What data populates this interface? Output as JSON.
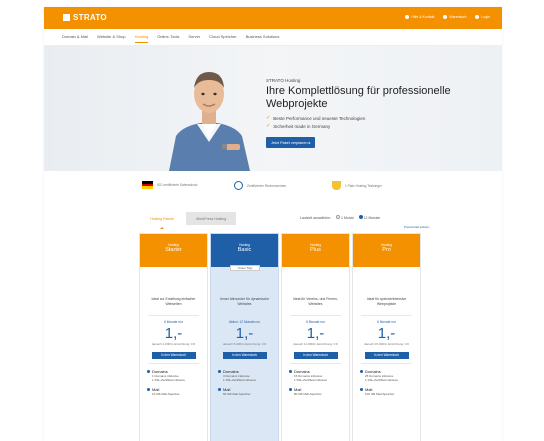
{
  "brand": {
    "name": "STRATO",
    "color": "#f39100",
    "blue": "#1f5fa8"
  },
  "toplinks": [
    "Hilfe & Kontakt",
    "Warenkorb",
    "Login"
  ],
  "nav": [
    "Domain & Mail",
    "Website & Shop",
    "Hosting",
    "Online-Tools",
    "Server",
    "Cloud Speicher",
    "Business Solutions"
  ],
  "hero": {
    "eyebrow": "STRATO Hosting",
    "title": "Ihre Komplettlösung für professionelle Webprojekte",
    "bullets": [
      "Beste Performance und neueste Technologien",
      "Sicherheit made in Germany"
    ],
    "button": "Jetzt Paket verplanen ▸"
  },
  "trust": [
    "ISO-zertifizierte Datenschutz",
    "Zertifizierter Rechenzentren",
    "1 Platz Hosting Testsieger"
  ],
  "tabs": [
    "Hosting Pakete",
    "WordPress Hosting"
  ],
  "duration": {
    "label": "Laufzeit auswählen:",
    "options": [
      "1 Monat",
      "12 Monate"
    ],
    "note": "Preisvorteil sichern"
  },
  "cards": [
    {
      "small": "Hosting",
      "name": "Starter",
      "desc": "Ideal zur Erstellung einfacher Webseiten",
      "months": "6 Monate nur",
      "price": "1,-",
      "after": "danach 4,00€/m Einrichtung: 0 €",
      "button": "In den Warenkorb",
      "f1": "Domains",
      "f1s": "1 Domains inklusive",
      "f1s2": "1 SSL-Zertifikat inklusive",
      "f2": "Mail",
      "f2s": "10 GB Mail-Speicher"
    },
    {
      "small": "Hosting",
      "name": "Basic",
      "badge": "Unser Tipp",
      "desc": "Unser Allrounder für dynamische Websites",
      "months": "Aktion: 12 Monate nur",
      "price": "1,-",
      "after": "danach 5,00€/m Einrichtung: 0 €",
      "button": "In den Warenkorb",
      "f1": "Domains",
      "f1s": "3 Domains inklusive",
      "f1s2": "1 SSL-Zertifikat inklusive",
      "f2": "Mail",
      "f2s": "50 GB Mail-Speicher"
    },
    {
      "small": "Hosting",
      "name": "Plus",
      "desc": "Ideal für Vereins- und Firmen-Websites",
      "months": "6 Monate nur",
      "price": "1,-",
      "after": "danach 11,00€/m Einrichtung: 0 €",
      "button": "In den Warenkorb",
      "f1": "Domains",
      "f1s": "15 Domains inklusive",
      "f1s2": "1 SSL-Zertifikat inklusive",
      "f2": "Mail",
      "f2s": "80 GB Mail-Speicher"
    },
    {
      "small": "Hosting",
      "name": "Pro",
      "desc": "Ideal für speicherintensive Webprojekte",
      "months": "6 Monate nur",
      "price": "1,-",
      "after": "danach 15,00€/m Einrichtung: 0 €",
      "button": "In den Warenkorb",
      "f1": "Domains",
      "f1s": "25 Domains inklusive",
      "f1s2": "1 SSL-Zertifikat inklusive",
      "f2": "Mail",
      "f2s": "100 GB Mail-Speicher"
    }
  ]
}
